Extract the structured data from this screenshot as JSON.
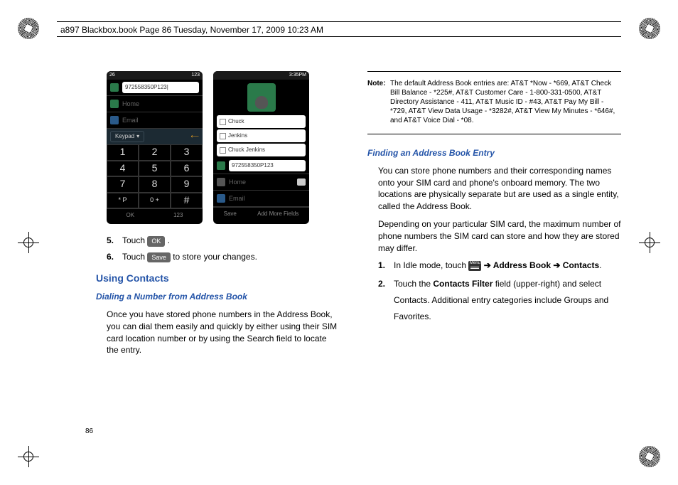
{
  "header": "a897 Blackbox.book  Page 86  Tuesday, November 17, 2009  10:23 AM",
  "page_number": "86",
  "phone1": {
    "status_left": "26",
    "status_right": "123",
    "input": "972558350P123|",
    "home": "Home",
    "email": "Email",
    "keypad_label": "Keypad",
    "keys": [
      "1",
      "2",
      "3",
      "4",
      "5",
      "6",
      "7",
      "8",
      "9",
      "*  P",
      "0  +",
      "#"
    ],
    "bottom_left": "OK",
    "bottom_right": "123"
  },
  "phone2": {
    "status_time": "3:35PM",
    "contacts": [
      "Chuck",
      "Jenkins",
      "Chuck Jenkins"
    ],
    "entry": "972558350P123",
    "home": "Home",
    "email": "Email",
    "bottom_left": "Save",
    "bottom_right": "Add More Fields"
  },
  "steps_left": [
    {
      "n": "5.",
      "pre": "Touch ",
      "btn": "OK",
      "post": " ."
    },
    {
      "n": "6.",
      "pre": "Touch ",
      "btn": "Save",
      "post": " to store your changes."
    }
  ],
  "section_title": "Using Contacts",
  "subsection_title": "Dialing a Number from Address Book",
  "para_left": "Once you have stored phone numbers in the Address Book, you can dial them easily and quickly by either using their SIM card location number or by using the Search field to locate the entry.",
  "note_label": "Note:",
  "note_text": "The default Address Book entries are: AT&T *Now - *669, AT&T Check Bill Balance - *225#, AT&T Customer Care - 1-800-331-0500, AT&T Directory Assistance - 411, AT&T Music ID - #43, AT&T Pay My Bill - *729, AT&T View Data Usage - *3282#, AT&T View My Minutes - *646#, and AT&T Voice Dial - *08.",
  "right_subsection": "Finding an Address Book Entry",
  "para_r1": "You can store phone numbers and their corresponding names onto your SIM card and phone's onboard memory. The two locations are physically separate but are used as a single entity, called the Address Book.",
  "para_r2": "Depending on your particular SIM card, the maximum number of phone numbers the SIM card can store and how they are stored may differ.",
  "steps_right": {
    "s1_pre": "In Idle mode, touch ",
    "s1_menu": "Menu",
    "s1_arrow": " ➔ ",
    "s1_b1": "Address Book",
    "s1_mid": " ➔ ",
    "s1_b2": "Contacts",
    "s1_post": ".",
    "s2_pre": "Touch the ",
    "s2_bold": "Contacts Filter",
    "s2_post": " field (upper-right) and select Contacts. Additional entry categories include Groups and Favorites."
  }
}
